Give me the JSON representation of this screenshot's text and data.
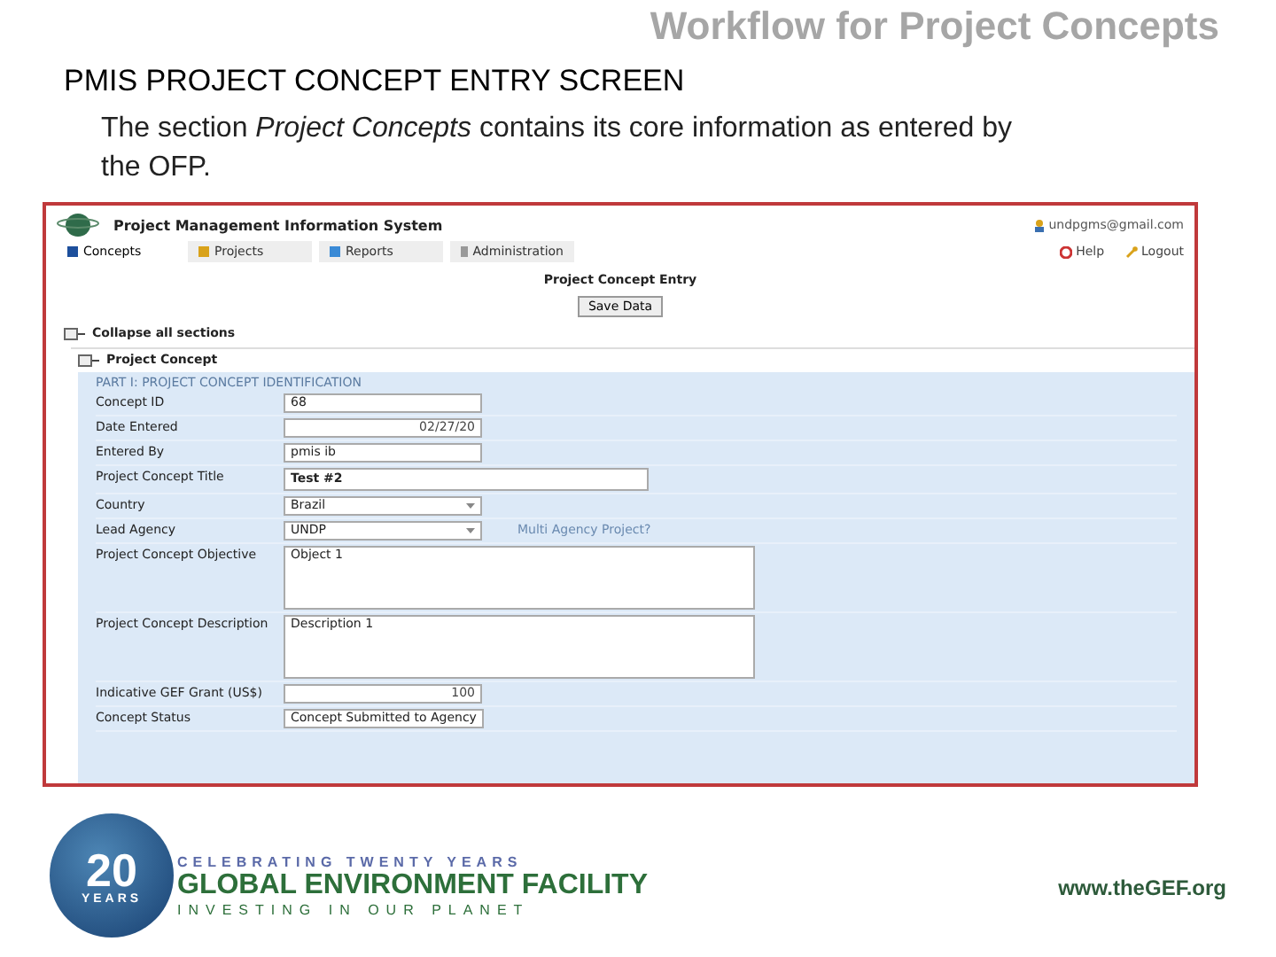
{
  "slide": {
    "title": "Workflow for Project Concepts",
    "heading": "PMIS PROJECT CONCEPT ENTRY SCREEN",
    "description": "The section *Project Concepts* contains its core information as entered by the OFP.",
    "footer": {
      "logo_number": "20",
      "logo_years": "YEARS",
      "tagline_top": "CELEBRATING TWENTY YEARS",
      "organization": "GLOBAL ENVIRONMENT FACILITY",
      "tagline_bottom": "INVESTING IN OUR PLANET",
      "website": "www.theGEF.org"
    }
  },
  "app": {
    "title": "Project Management Information System",
    "user": "undpgms@gmail.com",
    "help": "Help",
    "logout": "Logout",
    "tabs": [
      {
        "label": "Concepts",
        "selected": true
      },
      {
        "label": "Projects",
        "selected": false
      },
      {
        "label": "Reports",
        "selected": false
      },
      {
        "label": "Administration",
        "selected": false
      }
    ],
    "page_title": "Project Concept Entry",
    "save_button": "Save Data",
    "collapse_all": "Collapse all sections",
    "section_title": "Project Concept",
    "part_title": "PART I: PROJECT CONCEPT IDENTIFICATION",
    "fields": [
      {
        "label": "Concept ID",
        "kind": "text",
        "value": "68"
      },
      {
        "label": "Date Entered",
        "kind": "date",
        "value": "02/27/20"
      },
      {
        "label": "Entered By",
        "kind": "text",
        "value": "pmis ib"
      },
      {
        "label": "Project Concept Title",
        "kind": "wide",
        "value": "Test #2"
      },
      {
        "label": "Country",
        "kind": "select",
        "value": "Brazil"
      },
      {
        "label": "Lead Agency",
        "kind": "select",
        "value": "UNDP",
        "link": "Multi Agency Project?"
      },
      {
        "label": "Project Concept Objective",
        "kind": "textarea",
        "value": "Object 1"
      },
      {
        "label": "Project Concept Description",
        "kind": "textarea",
        "value": "Description 1"
      },
      {
        "label": "Indicative GEF Grant (US$)",
        "kind": "number",
        "value": "100"
      },
      {
        "label": "Concept Status",
        "kind": "text",
        "value": "Concept Submitted to Agency"
      }
    ]
  }
}
